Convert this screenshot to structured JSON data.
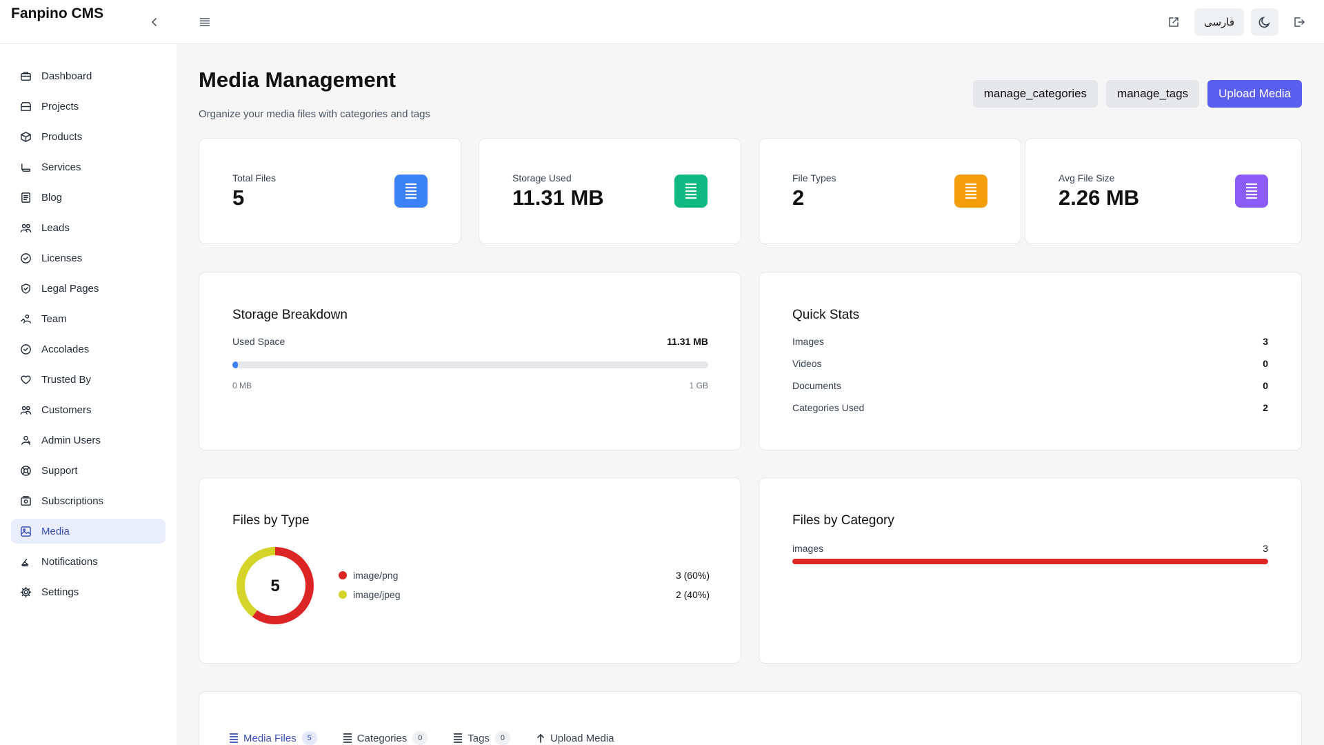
{
  "app": {
    "brand": "Fanpino CMS"
  },
  "topbar": {
    "language_label": "فارسی"
  },
  "sidebar": {
    "items": [
      {
        "label": "Dashboard",
        "icon": "briefcase-icon"
      },
      {
        "label": "Projects",
        "icon": "folder-icon"
      },
      {
        "label": "Products",
        "icon": "box-icon"
      },
      {
        "label": "Services",
        "icon": "service-icon"
      },
      {
        "label": "Blog",
        "icon": "document-icon"
      },
      {
        "label": "Leads",
        "icon": "people-icon"
      },
      {
        "label": "Licenses",
        "icon": "check-circle-icon"
      },
      {
        "label": "Legal Pages",
        "icon": "shield-icon"
      },
      {
        "label": "Team",
        "icon": "team-icon"
      },
      {
        "label": "Accolades",
        "icon": "check-circle-icon"
      },
      {
        "label": "Trusted By",
        "icon": "heart-icon"
      },
      {
        "label": "Customers",
        "icon": "people-icon"
      },
      {
        "label": "Admin Users",
        "icon": "admin-users-icon"
      },
      {
        "label": "Support",
        "icon": "lifebuoy-icon"
      },
      {
        "label": "Subscriptions",
        "icon": "subscriptions-icon"
      },
      {
        "label": "Media",
        "icon": "image-icon",
        "active": true
      },
      {
        "label": "Notifications",
        "icon": "bell-icon"
      },
      {
        "label": "Settings",
        "icon": "gear-icon"
      }
    ]
  },
  "page": {
    "title": "Media Management",
    "subtitle": "Organize your media files with categories and tags",
    "actions": {
      "manage_categories": "manage_categories",
      "manage_tags": "manage_tags",
      "upload": "Upload Media"
    }
  },
  "stats": [
    {
      "label": "Total Files",
      "value": "5",
      "color": "#3b82f6"
    },
    {
      "label": "Storage Used",
      "value": "11.31 MB",
      "color": "#10b981"
    },
    {
      "label": "File Types",
      "value": "2",
      "color": "#f59e0b"
    },
    {
      "label": "Avg File Size",
      "value": "2.26 MB",
      "color": "#8b5cf6"
    }
  ],
  "storage": {
    "title": "Storage Breakdown",
    "used_label": "Used Space",
    "used_value": "11.31 MB",
    "min_label": "0 MB",
    "max_label": "1 GB",
    "used_fraction": 0.011
  },
  "quick_stats": {
    "title": "Quick Stats",
    "rows": [
      {
        "label": "Images",
        "value": "3"
      },
      {
        "label": "Videos",
        "value": "0"
      },
      {
        "label": "Documents",
        "value": "0"
      },
      {
        "label": "Categories Used",
        "value": "2"
      }
    ]
  },
  "files_by_type": {
    "title": "Files by Type",
    "total": "5",
    "items": [
      {
        "label": "image/png",
        "value": "3 (60%)",
        "count": 3,
        "color": "#dc2626"
      },
      {
        "label": "image/jpeg",
        "value": "2 (40%)",
        "count": 2,
        "color": "#d4d42a"
      }
    ]
  },
  "files_by_category": {
    "title": "Files by Category",
    "items": [
      {
        "label": "images",
        "value": "3",
        "fraction": 1.0,
        "color": "#dc2626"
      }
    ]
  },
  "tabs": [
    {
      "label": "Media Files",
      "badge": "5",
      "active": true
    },
    {
      "label": "Categories",
      "badge": "0"
    },
    {
      "label": "Tags",
      "badge": "0"
    },
    {
      "label": "Upload Media",
      "badge": ""
    }
  ]
}
